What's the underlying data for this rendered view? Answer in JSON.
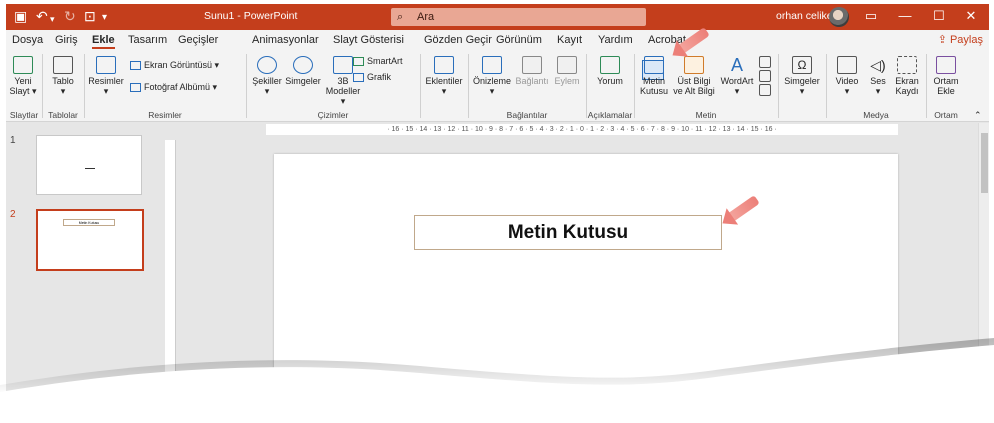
{
  "titlebar": {
    "title": "Sunu1  -  PowerPoint",
    "search_placeholder": "Ara",
    "user": "orhan celiker"
  },
  "tabs": [
    "Dosya",
    "Giriş",
    "Ekle",
    "Tasarım",
    "Geçişler",
    "Animasyonlar",
    "Slayt Gösterisi",
    "Gözden Geçir",
    "Görünüm",
    "Kayıt",
    "Yardım",
    "Acrobat"
  ],
  "share_label": "Paylaş",
  "ribbon": {
    "yeni_slayt": "Yeni Slayt",
    "tablo": "Tablo",
    "resimler": "Resimler",
    "ekran_goruntusu": "Ekran Görüntüsü",
    "fotograf_albumu": "Fotoğraf Albümü",
    "sekiller": "Şekiller",
    "simgeler": "Simgeler",
    "modeller_3b": "3B",
    "modeller_3b_line2": "Modeller",
    "smartart": "SmartArt",
    "grafik": "Grafik",
    "eklentiler": "Eklentiler",
    "onizleme": "Önizleme",
    "baglanti": "Bağlantı",
    "eylem": "Eylem",
    "yorum": "Yorum",
    "metin_kutusu": "Metin",
    "metin_kutusu_line2": "Kutusu",
    "ust_bilgi": "Üst Bilgi",
    "ust_bilgi_line2": "ve Alt Bilgi",
    "wordart": "WordArt",
    "simgeler2": "Simgeler",
    "video": "Video",
    "ses": "Ses",
    "ekran_kaydi": "Ekran",
    "ekran_kaydi_line2": "Kaydı",
    "ortam_ekle": "Ortam",
    "ortam_ekle_line2": "Ekle",
    "groups": [
      "Slaytlar",
      "Tablolar",
      "Resimler",
      "Çizimler",
      "Bağlantılar",
      "Açıklamalar",
      "Metin",
      "Medya",
      "Ortam"
    ]
  },
  "thumbnails": {
    "slide1_number": "1",
    "slide2_number": "2",
    "slide2_text": "Metin Kutusu"
  },
  "ruler_text": "· 16 · 15 · 14 · 13 · 12 · 11 · 10 · 9 · 8 · 7 · 6 · 5 · 4 · 3 · 2 · 1 · 0 · 1 · 2 · 3 · 4 · 5 · 6 · 7 · 8 · 9 · 10 · 11 · 12 · 13 · 14 · 15 · 16 ·",
  "slide": {
    "textbox": "Metin Kutusu"
  },
  "colors": {
    "accent": "#c43e1c",
    "arrow": "#ec7f78"
  }
}
